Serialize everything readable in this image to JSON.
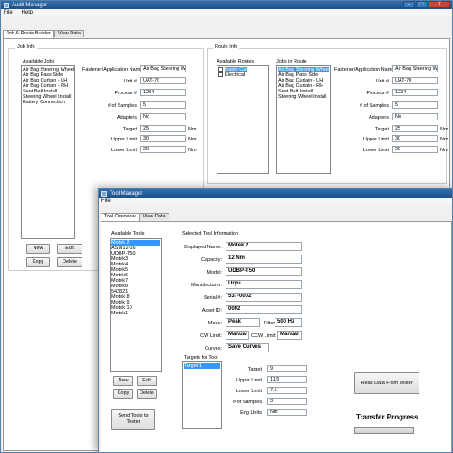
{
  "audit": {
    "title": "Audit Manager",
    "menu": [
      "File",
      "Help"
    ],
    "tabs": [
      "Job & Route Builder",
      "View Data"
    ],
    "job_info": {
      "heading": "Job Info",
      "available_jobs_label": "Available Jobs",
      "jobs": [
        "Air Bag Steering Wheel",
        "Air Bag Pass Side",
        "Air Bag Curtain - LH",
        "Air Bag Curtain - RH",
        "Seat Belt Install",
        "Steering Wheel Install",
        "Battery Connection"
      ],
      "fields": {
        "fastener_label": "Fastener/Application Name",
        "fastener": "Air Bag Steering Wh",
        "unit_label": "Unit #",
        "unit": "UAT-70",
        "process_label": "Process #",
        "process": "1234",
        "samples_label": "# of Samples",
        "samples": "5",
        "adapters_label": "Adapters",
        "adapters": "No",
        "target_label": "Target",
        "target": "25",
        "upper_label": "Upper Limit",
        "upper": "30",
        "lower_label": "Lower Limit",
        "lower": "20",
        "unit_nm": "Nm"
      },
      "buttons": {
        "new": "New",
        "edit": "Edit",
        "copy": "Copy",
        "delete": "Delete"
      }
    },
    "route_info": {
      "heading": "Route Info",
      "available_routes_label": "Available Routes",
      "routes": [
        "Inside Car",
        "Electrical"
      ],
      "jobs_in_route_label": "Jobs in Route",
      "jobs_in_route": [
        "Air Bag Steering Wheel",
        "Air Bag Pass Side",
        "Air Bag Curtain - LH",
        "Air Bag Curtain - RH",
        "Seat Belt Install",
        "Steering Wheel Install"
      ],
      "fields": {
        "fastener_label": "Fastener/Application Name",
        "fastener": "Air Bag Steering Wh",
        "unit_label": "Unit #",
        "unit": "UAT-70",
        "process_label": "Process #",
        "process": "1234",
        "samples_label": "# of Samples",
        "samples": "5",
        "adapters_label": "Adapters",
        "adapters": "No",
        "target_label": "Target",
        "target": "25",
        "upper_label": "Upper Limit",
        "upper": "30",
        "lower_label": "Lower Limit",
        "lower": "20",
        "unit_nm": "Nm"
      }
    }
  },
  "tool": {
    "title": "Tool Manager",
    "menu": [
      "File"
    ],
    "tabs": [
      "Tool Overview",
      "View Data"
    ],
    "available_tools_label": "Available Tools",
    "tools": [
      "Motek 2",
      "ASW12-16",
      "UDBP-T50",
      "Motek3",
      "Motek4",
      "Motek5",
      "Motek6",
      "Motek7",
      "Motek8",
      "543321",
      "Motek 8",
      "Motek 9",
      "Motek 10",
      "Motek1"
    ],
    "buttons": {
      "new": "New",
      "edit": "Edit",
      "copy": "Copy",
      "delete": "Delete",
      "send": "Send Tools to Tester",
      "read": "Read Data From Tester"
    },
    "selected_info_label": "Selected Tool Information",
    "info": {
      "display_name_label": "Displayed Name:",
      "display_name": "Motek 2",
      "capacity_label": "Capacity:",
      "capacity": "12 Nm",
      "model_label": "Model:",
      "model": "UDBP-T50",
      "manufacturer_label": "Manufacturer:",
      "manufacturer": "Uryu",
      "serial_label": "Serial #:",
      "serial": "537-0002",
      "asset_label": "Asset ID:",
      "asset": "0002",
      "mode_label": "Mode:",
      "mode": "Peak",
      "filter_label": "Filter",
      "filter": "500 Hz",
      "cw_label": "CW Limit:",
      "cw": "Manual",
      "ccw_label": "CCW Limit:",
      "ccw": "Manual",
      "curves_label": "Curves:",
      "curves": "Save Curves"
    },
    "targets_label": "Targets for Tool",
    "targets": [
      "Target 1"
    ],
    "target_fields": {
      "target_label": "Target",
      "target": "9",
      "upper_label": "Upper Limit",
      "upper": "11.5",
      "lower_label": "Lower Limit",
      "lower": "7.5",
      "samples_label": "# of Samples",
      "samples": "3",
      "eng_label": "Eng Units",
      "eng": "Nm"
    },
    "transfer_label": "Transfer Progress",
    "transfer_progress": 0
  },
  "window_controls": {
    "minimize": "–",
    "maximize": "□",
    "close": "X"
  }
}
